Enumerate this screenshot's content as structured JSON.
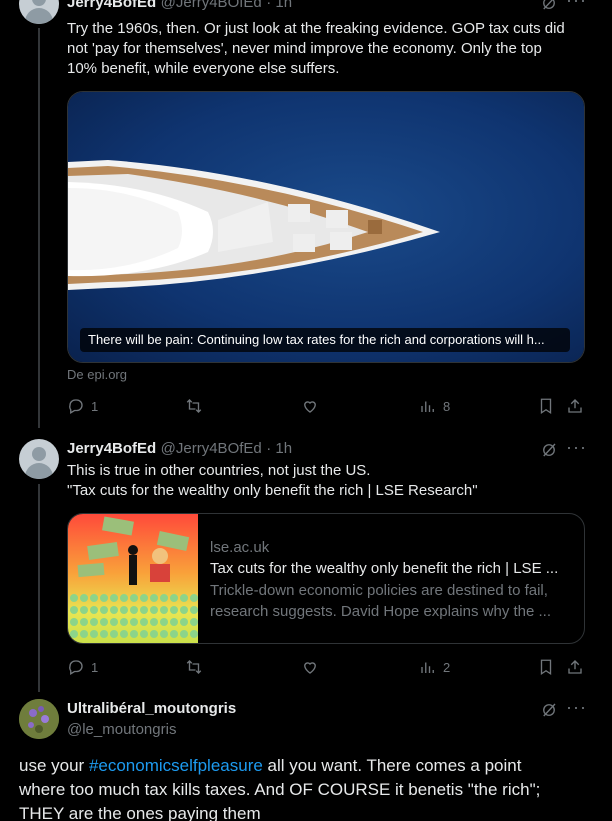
{
  "tweet1": {
    "name": "Jerry4BofEd",
    "handle": "@Jerry4BOfEd",
    "time": "· 1h",
    "text_line1": "Try the 1960s, then. Or just look at the freaking evidence. GOP tax cuts did",
    "text_line2": "not 'pay for themselves', never mind improve the economy. Only the top",
    "text_line3": "10% benefit, while everyone else suffers.",
    "card_caption": "There will be pain: Continuing low tax rates for the rich and corporations will h...",
    "card_source": "De epi.org",
    "replies": "1",
    "views": "8"
  },
  "tweet2": {
    "name": "Jerry4BofEd",
    "handle": "@Jerry4BOfEd",
    "time": "· 1h",
    "text_line1": "This is true in other countries, not just the US.",
    "text_line2": "\"Tax cuts for the wealthy only benefit the rich | LSE Research\"",
    "card_domain": "lse.ac.uk",
    "card_title": "Tax cuts for the wealthy only benefit the rich | LSE ...",
    "card_desc_line1": "Trickle-down economic policies are destined to fail,",
    "card_desc_line2": "research suggests. David Hope explains why the ...",
    "replies": "1",
    "views": "2"
  },
  "tweet3": {
    "name": "Ultralibéral_moutongris",
    "handle": "@le_moutongris",
    "text_pre": "use your ",
    "hashtag": "#economicselfpleasure",
    "text_post": " all you want. There comes a point",
    "text_line2": "where too much tax kills taxes. And OF COURSE it benetis \"the rich\";",
    "text_line3": "THEY are the ones paying them"
  },
  "icons": {
    "more": "more-icon",
    "grok": "grok-icon"
  },
  "colors": {
    "accent": "#1d9bf0",
    "muted": "#71767b",
    "text": "#e7e9ea",
    "background": "#000000"
  }
}
